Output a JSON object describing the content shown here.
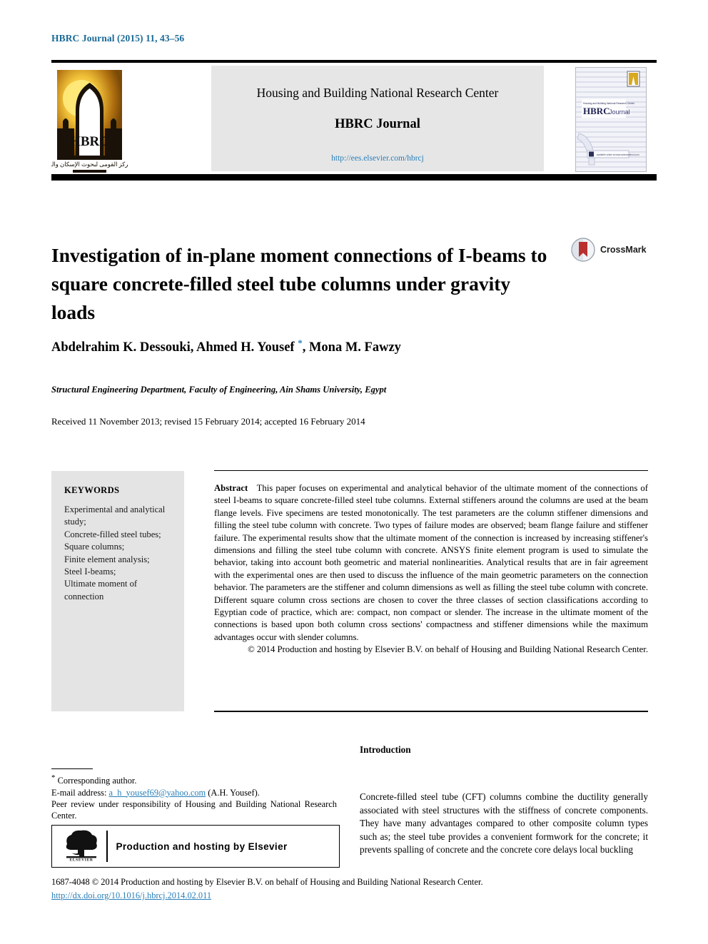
{
  "running_head": "HBRC Journal (2015) 11, 43–56",
  "masthead": {
    "organization": "Housing and Building National Research Center",
    "journal_title": "HBRC Journal",
    "url": "http://ees.elsevier.com/hbrcj",
    "logo_acronym": "HBRC",
    "logo_arabic": "المركز القومي لبحوث الإسكان والبناء",
    "cover_acronym": "HBRC",
    "cover_word": "Journal",
    "cover_strapline": "Housing and Building National Research Center"
  },
  "article": {
    "title": "Investigation of in-plane moment connections of I-beams to square concrete-filled steel tube columns under gravity loads",
    "crossmark_label": "CrossMark",
    "authors": "Abdelrahim K. Dessouki, Ahmed H. Yousef ",
    "authors_star": "*",
    "authors_tail": ", Mona M. Fawzy",
    "affiliation": "Structural Engineering Department, Faculty of Engineering, Ain Shams University, Egypt",
    "history": "Received 11 November 2013; revised 15 February 2014; accepted 16 February 2014"
  },
  "keywords": {
    "heading": "KEYWORDS",
    "items": [
      "Experimental and analytical study;",
      "Concrete-filled steel tubes;",
      "Square columns;",
      "Finite element analysis;",
      "Steel I-beams;",
      "Ultimate moment of connection"
    ]
  },
  "abstract": {
    "heading": "Abstract",
    "body": "This paper focuses on experimental and analytical behavior of the ultimate moment of the connections of steel I-beams to square concrete-filled steel tube columns. External stiffeners around the columns are used at the beam flange levels. Five specimens are tested monotonically. The test parameters are the column stiffener dimensions and filling the steel tube column with concrete. Two types of failure modes are observed; beam flange failure and stiffener failure. The experimental results show that the ultimate moment of the connection is increased by increasing stiffener's dimensions and filling the steel tube column with concrete. ANSYS finite element program is used to simulate the behavior, taking into account both geometric and material nonlinearities. Analytical results that are in fair agreement with the experimental ones are then used to discuss the influence of the main geometric parameters on the connection behavior. The parameters are the stiffener and column dimensions as well as filling the steel tube column with concrete. Different square column cross sections are chosen to cover the three classes of section classifications according to Egyptian code of practice, which are: compact, non compact or slender. The increase in the ultimate moment of the connections is based upon both column cross sections' compactness and stiffener dimensions while the maximum advantages occur with slender columns.",
    "copyright": "© 2014 Production and hosting by Elsevier B.V. on behalf of Housing and Building National Research Center."
  },
  "footnotes": {
    "corresponding": "Corresponding author.",
    "email_label": "E-mail address:",
    "email": "a_h_yousef69@yahoo.com",
    "email_owner": "(A.H. Yousef).",
    "peer_review": "Peer review under responsibility of Housing and Building National Research Center.",
    "elsevier_caption": "Production and hosting by Elsevier",
    "elsevier_wordmark": "ELSEVIER"
  },
  "introduction": {
    "heading": "Introduction",
    "body": "Concrete-filled steel tube (CFT) columns combine the ductility generally associated with steel structures with the stiffness of concrete components. They have many advantages compared to other composite column types such as; the steel tube provides a convenient formwork for the concrete; it prevents spalling of concrete and the concrete core delays local buckling"
  },
  "footer": {
    "issn_line": "1687-4048 © 2014 Production and hosting by Elsevier B.V. on behalf of Housing and Building National Research Center.",
    "doi": "http://dx.doi.org/10.1016/j.hbrcj.2014.02.011"
  },
  "colors": {
    "link": "#2a7fb8",
    "running_head": "#1b6a96",
    "keywords_bg": "#e4e4e4",
    "masthead_bg": "#e6e6e6"
  }
}
